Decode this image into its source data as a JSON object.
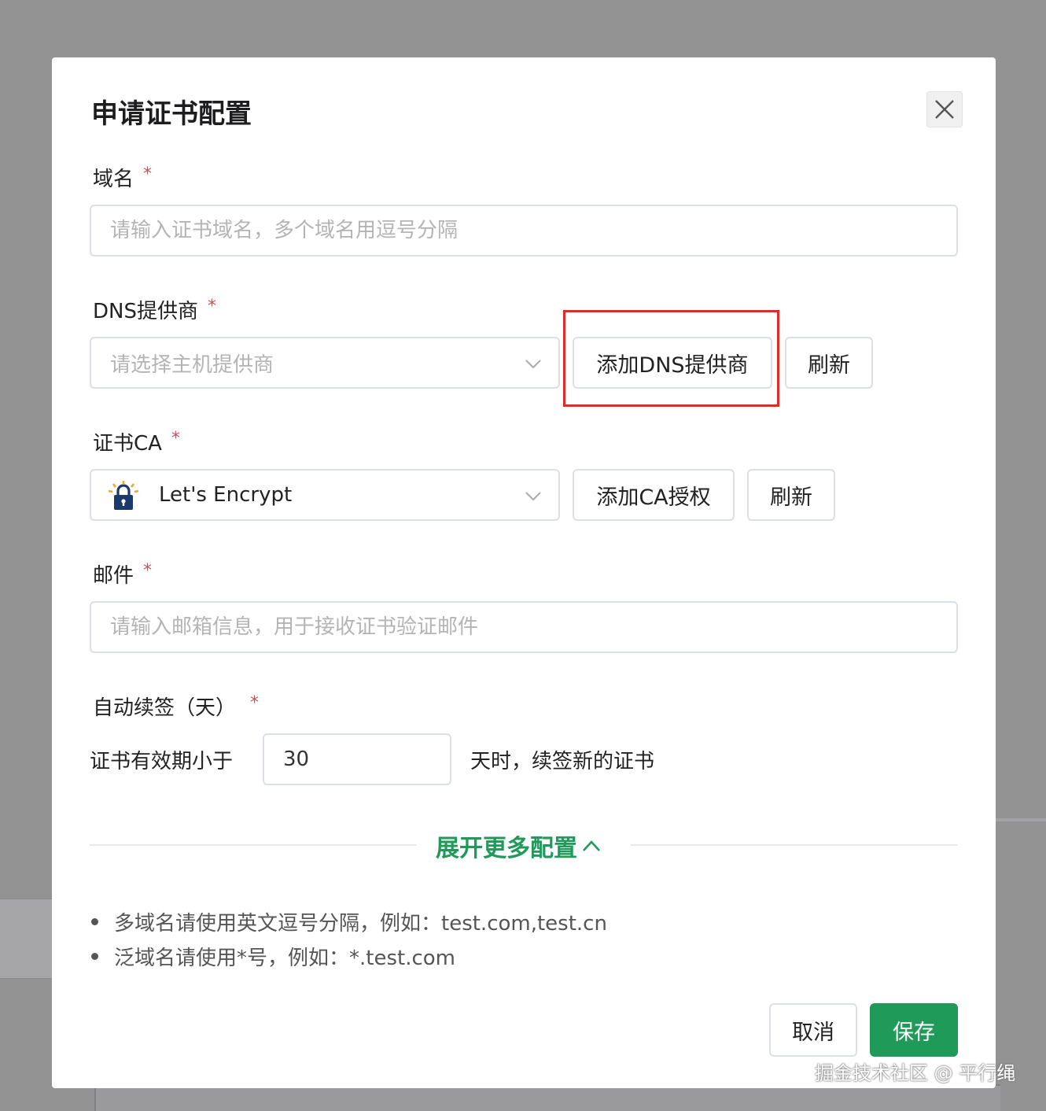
{
  "dialog": {
    "title": "申请证书配置",
    "close_icon": "close-icon"
  },
  "domain": {
    "label": "域名",
    "required_mark": "*",
    "placeholder": "请输入证书域名，多个域名用逗号分隔",
    "value": ""
  },
  "dns": {
    "label": "DNS提供商",
    "required_mark": "*",
    "placeholder": "请选择主机提供商",
    "add_button": "添加DNS提供商",
    "refresh_button": "刷新"
  },
  "ca": {
    "label": "证书CA",
    "required_mark": "*",
    "selected": "Let's Encrypt",
    "selected_icon": "lets-encrypt-lock-icon",
    "add_button": "添加CA授权",
    "refresh_button": "刷新"
  },
  "email": {
    "label": "邮件",
    "required_mark": "*",
    "placeholder": "请输入邮箱信息，用于接收证书验证邮件",
    "value": ""
  },
  "auto_renew": {
    "label": "自动续签（天）",
    "required_mark": "*",
    "prefix": "证书有效期小于",
    "days_value": "30",
    "suffix": "天时，续签新的证书"
  },
  "expand": {
    "label": "展开更多配置",
    "icon": "chevron-up-icon"
  },
  "tips": [
    "多域名请使用英文逗号分隔，例如：test.com,test.cn",
    "泛域名请使用*号，例如：*.test.com"
  ],
  "footer": {
    "cancel": "取消",
    "save": "保存"
  },
  "watermark": "掘金技术社区 @ 平行绳",
  "colors": {
    "accent": "#1f9a58",
    "required": "#e5484d",
    "highlight_box": "#e62a21",
    "overlay": "#939394"
  }
}
